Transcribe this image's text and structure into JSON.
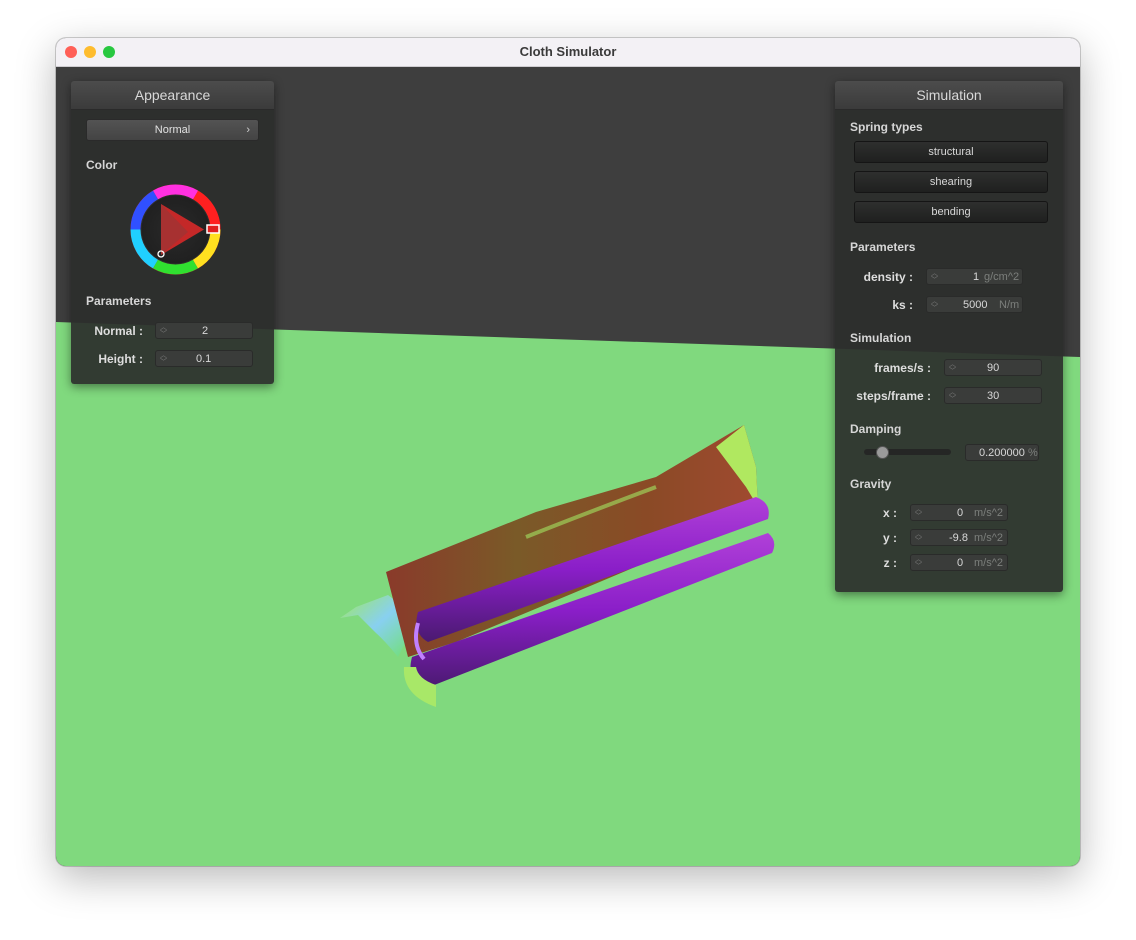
{
  "window": {
    "title": "Cloth Simulator",
    "traffic_lights": {
      "close": "#ff5f57",
      "minimize": "#febc2e",
      "maximize": "#28c840"
    }
  },
  "scene": {
    "background_color": "#3e3e3e",
    "ground_color": "#80d97e"
  },
  "appearance": {
    "title": "Appearance",
    "shader_dropdown": "Normal",
    "dropdown_chevron": "›",
    "color_label": "Color",
    "selected_color": "#e02020",
    "parameters_label": "Parameters",
    "normal": {
      "label": "Normal :",
      "value": "2"
    },
    "height": {
      "label": "Height :",
      "value": "0.1"
    }
  },
  "simulation": {
    "title": "Simulation",
    "spring_types_label": "Spring types",
    "springs": [
      "structural",
      "shearing",
      "bending"
    ],
    "parameters_label": "Parameters",
    "density": {
      "label": "density :",
      "value": "1",
      "unit": "g/cm^2"
    },
    "ks": {
      "label": "ks :",
      "value": "5000",
      "unit": "N/m"
    },
    "simulation_label": "Simulation",
    "frames": {
      "label": "frames/s :",
      "value": "90"
    },
    "steps": {
      "label": "steps/frame :",
      "value": "30"
    },
    "damping_label": "Damping",
    "damping": {
      "value": "0.200000",
      "unit": "%",
      "slider_fraction": 0.2
    },
    "gravity_label": "Gravity",
    "gravity": [
      {
        "label": "x :",
        "value": "0",
        "unit": "m/s^2"
      },
      {
        "label": "y :",
        "value": "-9.8",
        "unit": "m/s^2"
      },
      {
        "label": "z :",
        "value": "0",
        "unit": "m/s^2"
      }
    ]
  }
}
